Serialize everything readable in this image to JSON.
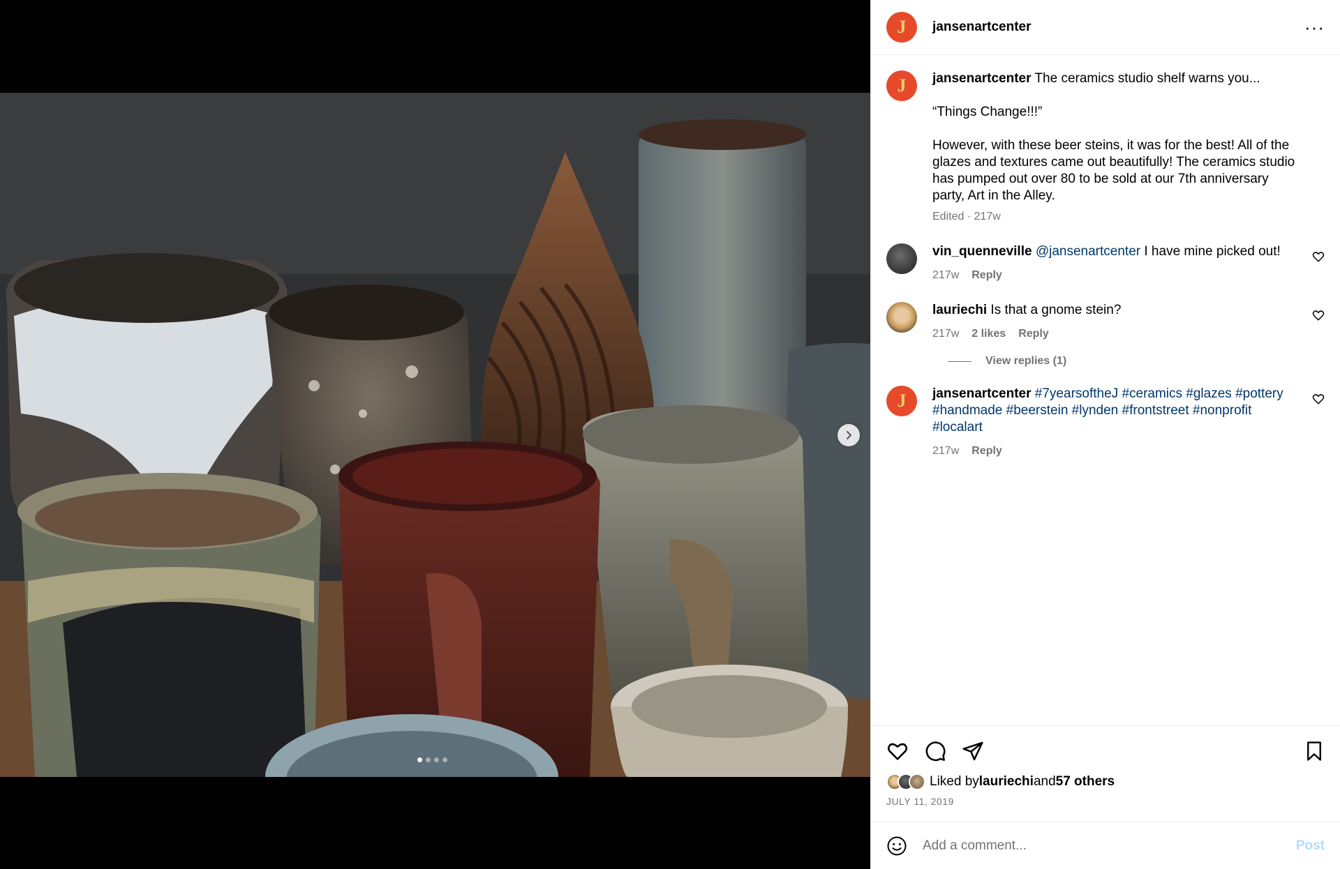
{
  "post": {
    "username": "jansenartcenter",
    "avatar_letter": "J",
    "more_icon": "more-horizontal-icon"
  },
  "media": {
    "image_alt": "ceramic beer steins on a studio shelf",
    "slide_count": 4,
    "active_slide": 1,
    "next_icon": "chevron-right-icon"
  },
  "caption": {
    "username": "jansenartcenter",
    "line1": "The ceramics studio shelf warns you...",
    "line2": "“Things Change!!!”",
    "line3": "However, with these beer steins, it was for the best! All of the glazes and textures came out beautifully! The ceramics studio has pumped out over 80 to be sold at our 7th anniversary party, Art in the Alley.",
    "edited": "Edited · 217w"
  },
  "comments": [
    {
      "username": "vin_quenneville",
      "mention": "@jansenartcenter",
      "text": " I have mine picked out!",
      "time": "217w",
      "reply": "Reply"
    },
    {
      "username": "lauriechi",
      "text": " Is that a gnome stein?",
      "time": "217w",
      "likes": "2 likes",
      "reply": "Reply",
      "view_replies": "View replies (1)"
    },
    {
      "username": "jansenartcenter",
      "hashtags": [
        "#7yearsoftheJ",
        "#ceramics",
        "#glazes",
        "#pottery",
        "#handmade",
        "#beerstein",
        "#lynden",
        "#frontstreet",
        "#nonprofit",
        "#localart"
      ],
      "time": "217w",
      "reply": "Reply"
    }
  ],
  "actions": {
    "like_icon": "heart-icon",
    "comment_icon": "comment-icon",
    "share_icon": "send-icon",
    "save_icon": "bookmark-icon",
    "liked_by_prefix": "Liked by ",
    "liked_by_user": "lauriechi",
    "liked_by_mid": " and ",
    "liked_by_others": "57 others",
    "date": "JULY 11, 2019"
  },
  "composer": {
    "placeholder": "Add a comment...",
    "post_label": "Post",
    "emoji_icon": "emoji-icon"
  },
  "colors": {
    "brand_avatar": "#e64a2b",
    "link": "#00376b",
    "post_disabled": "#b3dbff",
    "muted": "#737373"
  }
}
